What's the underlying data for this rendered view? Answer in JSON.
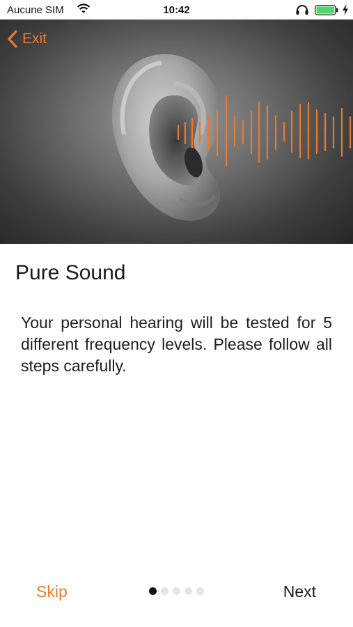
{
  "status_bar": {
    "carrier": "Aucune SIM",
    "time": "10:42",
    "icons": [
      "wifi-icon",
      "headphones-icon",
      "battery-icon",
      "charging-icon"
    ],
    "battery_color": "#4cd964"
  },
  "header": {
    "exit_label": "Exit",
    "exit_icon": "chevron-left-icon"
  },
  "hero": {
    "subject": "ear-with-sound-wave",
    "wave_color": "#e87b2f"
  },
  "content": {
    "title": "Pure Sound",
    "description": "Your personal hearing will be tested for 5 different frequency levels. Please follow all steps carefully."
  },
  "footer": {
    "skip_label": "Skip",
    "next_label": "Next",
    "page_indicator": {
      "current": 1,
      "total": 5
    }
  },
  "colors": {
    "accent": "#e87b2f",
    "text": "#1a1a1a",
    "background": "#ffffff"
  }
}
